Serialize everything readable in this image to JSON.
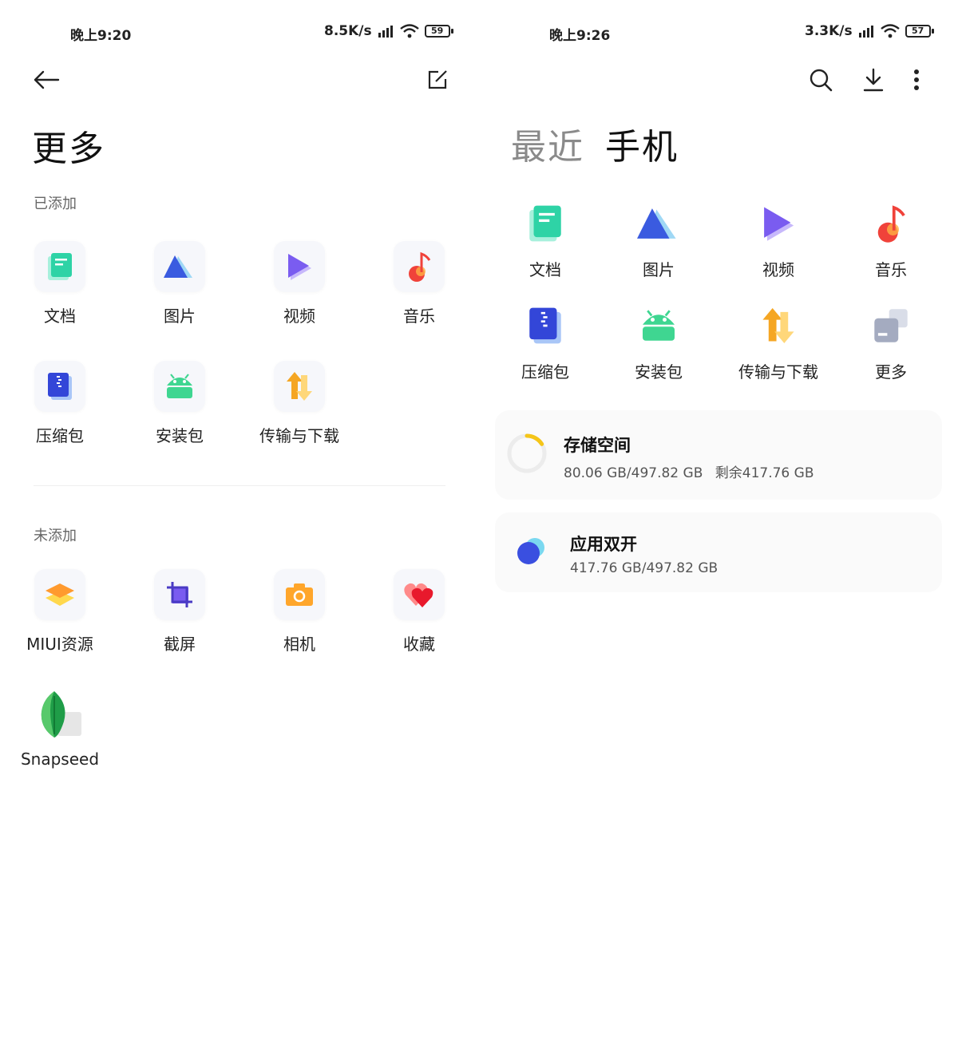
{
  "left": {
    "status": {
      "time": "晚上9:20",
      "speed": "8.5K/s",
      "battery": "59"
    },
    "header": {
      "back_icon": "arrow-left-icon",
      "edit_icon": "edit-icon"
    },
    "title": "更多",
    "added_label": "已添加",
    "added_items": [
      {
        "label": "文档",
        "icon": "document-icon"
      },
      {
        "label": "图片",
        "icon": "image-icon"
      },
      {
        "label": "视频",
        "icon": "video-icon"
      },
      {
        "label": "音乐",
        "icon": "music-icon"
      },
      {
        "label": "压缩包",
        "icon": "archive-icon"
      },
      {
        "label": "安装包",
        "icon": "android-icon"
      },
      {
        "label": "传输与下载",
        "icon": "transfer-icon"
      }
    ],
    "not_added_label": "未添加",
    "not_added_items": [
      {
        "label": "MIUI资源",
        "icon": "layers-icon"
      },
      {
        "label": "截屏",
        "icon": "crop-icon"
      },
      {
        "label": "相机",
        "icon": "camera-icon"
      },
      {
        "label": "收藏",
        "icon": "heart-icon"
      },
      {
        "label": "Snapseed",
        "icon": "snapseed-icon"
      }
    ]
  },
  "right": {
    "status": {
      "time": "晚上9:26",
      "speed": "3.3K/s",
      "battery": "57"
    },
    "header": {
      "search_icon": "search-icon",
      "download_icon": "download-icon",
      "more_icon": "more-vertical-icon"
    },
    "tabs": [
      {
        "label": "最近",
        "active": false
      },
      {
        "label": "手机",
        "active": true
      }
    ],
    "categories": [
      {
        "label": "文档",
        "icon": "document-icon"
      },
      {
        "label": "图片",
        "icon": "image-icon"
      },
      {
        "label": "视频",
        "icon": "video-icon"
      },
      {
        "label": "音乐",
        "icon": "music-icon"
      },
      {
        "label": "压缩包",
        "icon": "archive-icon"
      },
      {
        "label": "安装包",
        "icon": "android-icon"
      },
      {
        "label": "传输与下载",
        "icon": "transfer-icon"
      },
      {
        "label": "更多",
        "icon": "more-apps-icon"
      }
    ],
    "storage": {
      "title": "存储空间",
      "used": "80.06 GB/497.82 GB",
      "free": "剩余417.76 GB",
      "used_fraction": 0.161
    },
    "dual_app": {
      "title": "应用双开",
      "size": "417.76 GB/497.82 GB"
    }
  },
  "colors": {
    "doc": "#2ed3a6",
    "image": "#3a5be0",
    "video": "#7a5cf0",
    "music": "#f0423a",
    "archive": "#3346d8",
    "android": "#3fd691",
    "transfer": "#f5a623",
    "storage_ring": "#f5c518"
  }
}
